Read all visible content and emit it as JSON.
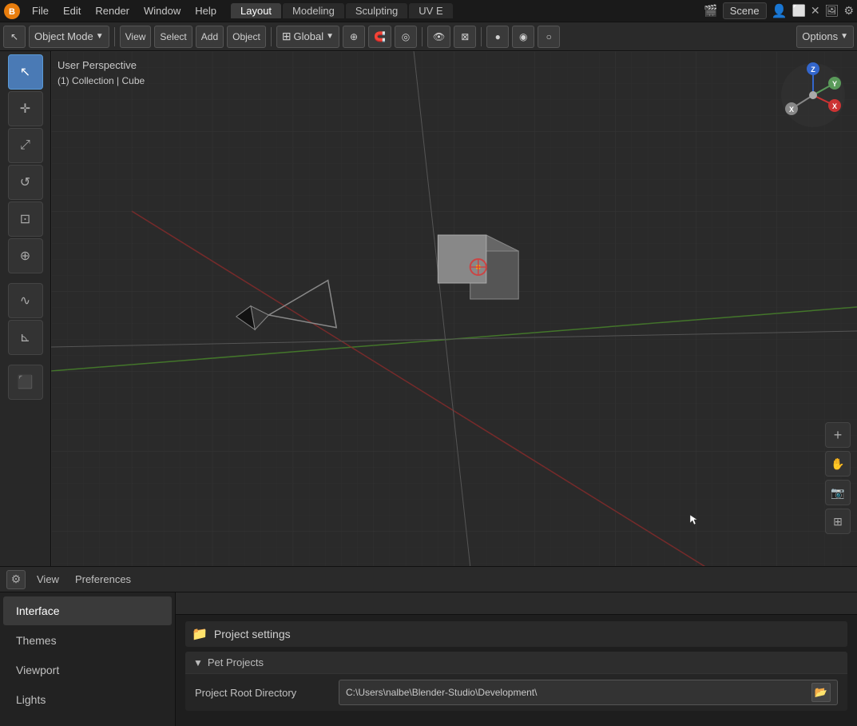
{
  "topMenu": {
    "menuItems": [
      "File",
      "Edit",
      "Render",
      "Window",
      "Help"
    ],
    "workspaceTabs": [
      {
        "label": "Layout",
        "active": true
      },
      {
        "label": "Modeling",
        "active": false
      },
      {
        "label": "Sculpting",
        "active": false
      },
      {
        "label": "UV E",
        "active": false
      }
    ],
    "sceneLabel": "Scene",
    "rightIcons": [
      "user-icon",
      "window-icon",
      "close-icon",
      "render-icon",
      "settings-icon"
    ]
  },
  "toolbar": {
    "objectMode": "Object Mode",
    "view": "View",
    "select": "Select",
    "add": "Add",
    "object": "Object",
    "global": "Global",
    "options": "Options"
  },
  "viewport": {
    "perspectiveLabel": "User Perspective",
    "collectionLabel": "(1) Collection | Cube",
    "backgroundColor": "#2a2a2a"
  },
  "leftShelf": {
    "tools": [
      {
        "icon": "↖",
        "name": "select-tool",
        "active": true
      },
      {
        "icon": "✛",
        "name": "cursor-tool",
        "active": false
      },
      {
        "icon": "⤢",
        "name": "move-tool",
        "active": false
      },
      {
        "icon": "↺",
        "name": "rotate-tool",
        "active": false
      },
      {
        "icon": "⊡",
        "name": "scale-tool",
        "active": false
      },
      {
        "icon": "⊕",
        "name": "transform-tool",
        "active": false
      },
      {
        "icon": "∿",
        "name": "annotate-tool",
        "active": false
      },
      {
        "icon": "⊾",
        "name": "measure-tool",
        "active": false
      },
      {
        "icon": "⬛",
        "name": "add-cube-tool",
        "active": false
      }
    ]
  },
  "navGizmo": {
    "xColor": "#cc3333",
    "yColor": "#5a9a5a",
    "zColor": "#3366cc"
  },
  "bottomPanel": {
    "gearLabel": "⚙",
    "viewLabel": "View",
    "preferencesLabel": "Preferences"
  },
  "prefsSidebar": {
    "items": [
      {
        "label": "Interface",
        "active": true
      },
      {
        "label": "Themes",
        "active": false
      },
      {
        "label": "Viewport",
        "active": false
      },
      {
        "label": "Lights",
        "active": false
      }
    ]
  },
  "prefsMain": {
    "sectionTitle": "Project settings",
    "group": {
      "label": "Pet Projects",
      "collapsed": false
    },
    "rows": [
      {
        "label": "Project Root Directory",
        "value": "C:\\Users\\nalbe\\Blender-Studio\\Development\\"
      }
    ]
  }
}
